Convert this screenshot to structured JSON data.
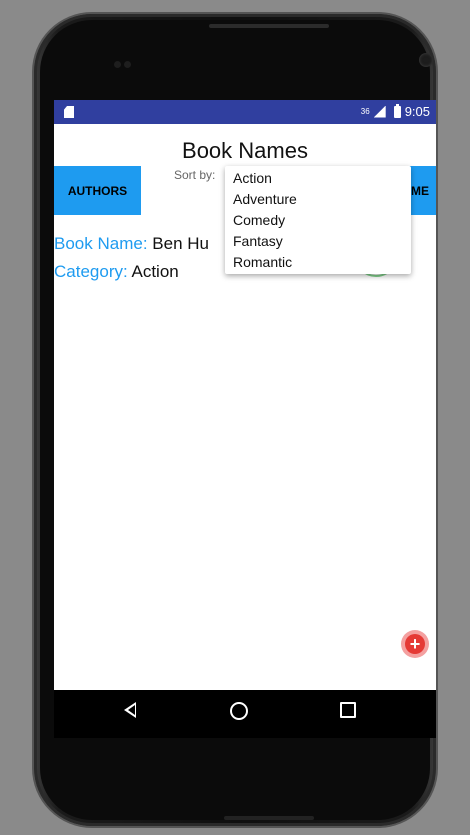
{
  "status_bar": {
    "time": "9:05",
    "network": "36",
    "icons": [
      "sd-card-icon",
      "signal-icon",
      "battery-icon"
    ]
  },
  "header": {
    "title": "Book Names",
    "sort_label": "Sort by:"
  },
  "buttons": {
    "authors": "AUTHORS",
    "right_partial": "ME"
  },
  "book": {
    "name_label": "Book Name:",
    "name_value": "Ben Hu",
    "category_label": "Category:",
    "category_value": "Action"
  },
  "dropdown": {
    "options": [
      "Action",
      "Adventure",
      "Comedy",
      "Fantasy",
      "Romantic"
    ]
  },
  "fab": {
    "icon": "add-circle-icon",
    "color": "#e53935"
  },
  "nav": {
    "icons": [
      "back-icon",
      "home-icon",
      "recent-apps-icon"
    ]
  },
  "colors": {
    "status_bar": "#303f9f",
    "accent": "#1e9bf0"
  }
}
